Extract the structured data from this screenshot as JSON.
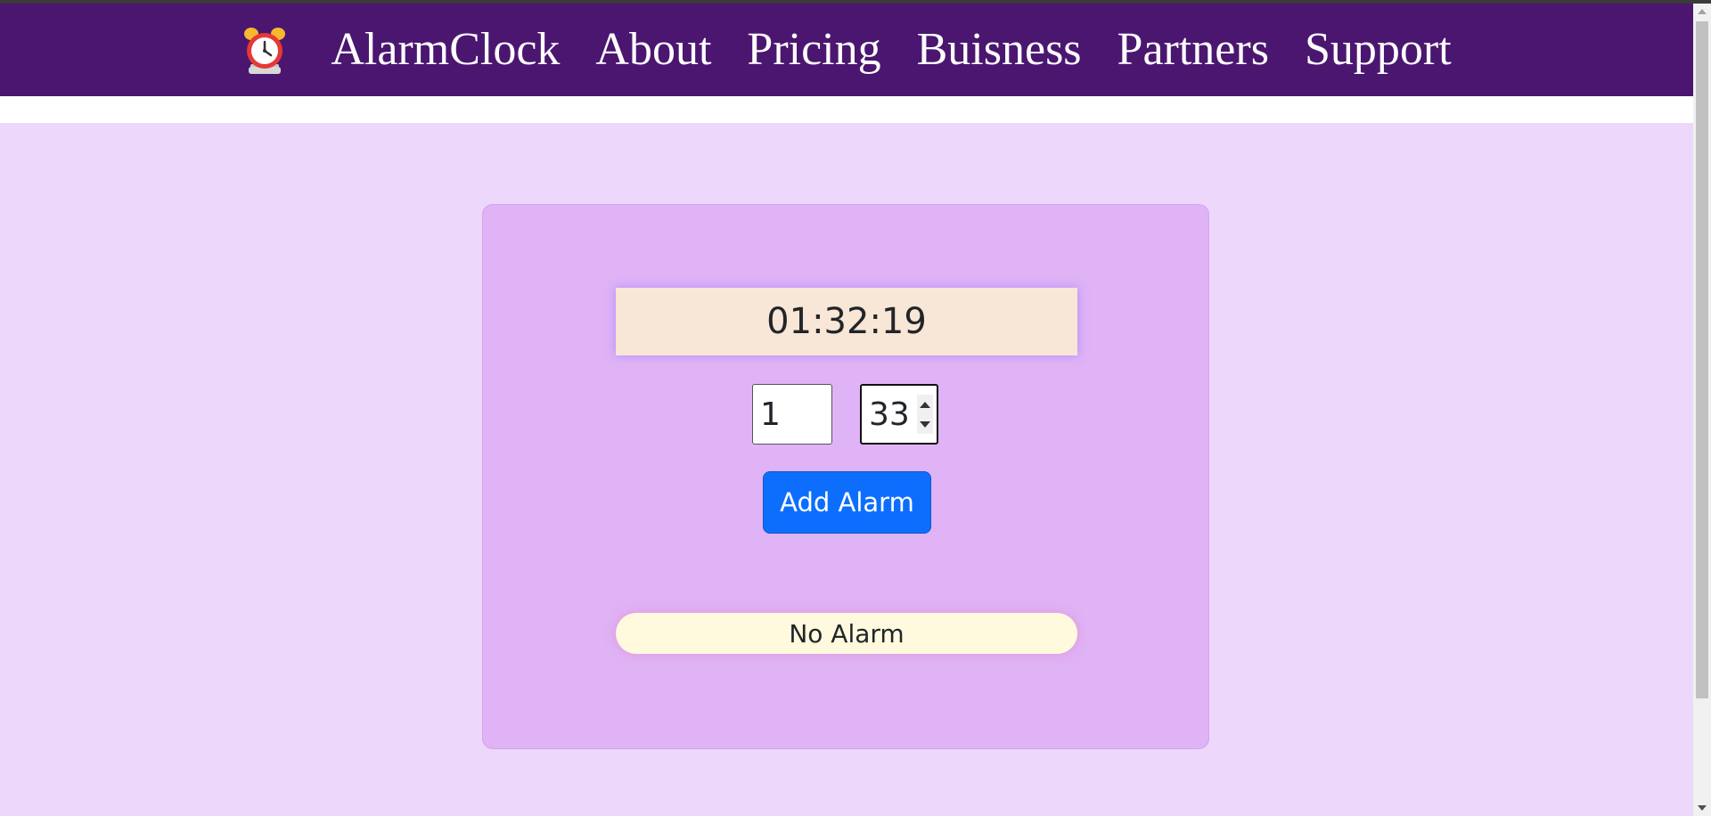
{
  "nav": {
    "logo_icon": "alarm-clock-icon",
    "links": [
      "AlarmClock",
      "About",
      "Pricing",
      "Buisness",
      "Partners",
      "Support"
    ]
  },
  "clock": {
    "time": "01:32:19"
  },
  "alarm_inputs": {
    "hour_value": "1",
    "minute_value": "33"
  },
  "add_button": {
    "label": "Add Alarm"
  },
  "alarm_status": {
    "text": "No Alarm"
  },
  "colors": {
    "navbar": "#4b1670",
    "page_background": "#edd8fb",
    "card_background": "#dfb3f5",
    "clock_background": "#f8e6d6",
    "button_primary": "#0d6efd",
    "status_background": "#fff9dd"
  }
}
